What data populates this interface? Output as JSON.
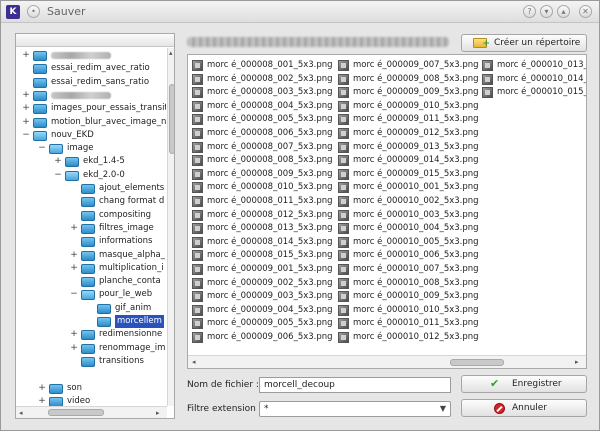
{
  "window": {
    "title": "Sauver"
  },
  "tree": {
    "items": [
      {
        "label": "",
        "blurred": true,
        "depth": 0,
        "toggle": "+",
        "blur_width": 60
      },
      {
        "label": "essai_redim_avec_ratio",
        "depth": 0,
        "toggle": ""
      },
      {
        "label": "essai_redim_sans_ratio",
        "depth": 0,
        "toggle": ""
      },
      {
        "label": "",
        "blurred": true,
        "depth": 0,
        "toggle": "+",
        "blur_width": 60
      },
      {
        "label": "images_pour_essais_transit",
        "depth": 0,
        "toggle": "+"
      },
      {
        "label": "motion_blur_avec_image_n",
        "depth": 0,
        "toggle": "+"
      },
      {
        "label": "nouv_EKD",
        "depth": 0,
        "toggle": "−",
        "open": true
      },
      {
        "label": "image",
        "depth": 1,
        "toggle": "−",
        "open": true
      },
      {
        "label": "ekd_1.4-5",
        "depth": 2,
        "toggle": "+"
      },
      {
        "label": "ekd_2.0-0",
        "depth": 2,
        "toggle": "−",
        "open": true
      },
      {
        "label": "ajout_elements",
        "depth": 3,
        "toggle": ""
      },
      {
        "label": "chang format d",
        "depth": 3,
        "toggle": ""
      },
      {
        "label": "compositing",
        "depth": 3,
        "toggle": ""
      },
      {
        "label": "filtres_image",
        "depth": 3,
        "toggle": "+"
      },
      {
        "label": "informations",
        "depth": 3,
        "toggle": ""
      },
      {
        "label": "masque_alpha_",
        "depth": 3,
        "toggle": "+"
      },
      {
        "label": "multiplication_i",
        "depth": 3,
        "toggle": "+"
      },
      {
        "label": "planche_conta",
        "depth": 3,
        "toggle": ""
      },
      {
        "label": "pour_le_web",
        "depth": 3,
        "toggle": "−",
        "open": true
      },
      {
        "label": "gif_anim",
        "depth": 4,
        "toggle": ""
      },
      {
        "label": "morcellem",
        "depth": 4,
        "toggle": "",
        "selected": true
      },
      {
        "label": "redimensionne",
        "depth": 3,
        "toggle": "+"
      },
      {
        "label": "renommage_im",
        "depth": 3,
        "toggle": "+"
      },
      {
        "label": "transitions",
        "depth": 3,
        "toggle": ""
      },
      {
        "label": "",
        "depth": 1,
        "toggle": "",
        "spacer": true
      },
      {
        "label": "son",
        "depth": 1,
        "toggle": "+"
      },
      {
        "label": "video",
        "depth": 1,
        "toggle": "+"
      }
    ]
  },
  "toolbar": {
    "new_dir_label": "Créer un répertoire"
  },
  "files": {
    "columns": [
      [
        "morc é_000008_001_5x3.png",
        "morc é_000008_002_5x3.png",
        "morc é_000008_003_5x3.png",
        "morc é_000008_004_5x3.png",
        "morc é_000008_005_5x3.png",
        "morc é_000008_006_5x3.png",
        "morc é_000008_007_5x3.png",
        "morc é_000008_008_5x3.png",
        "morc é_000008_009_5x3.png",
        "morc é_000008_010_5x3.png",
        "morc é_000008_011_5x3.png",
        "morc é_000008_012_5x3.png",
        "morc é_000008_013_5x3.png",
        "morc é_000008_014_5x3.png",
        "morc é_000008_015_5x3.png",
        "morc é_000009_001_5x3.png",
        "morc é_000009_002_5x3.png",
        "morc é_000009_003_5x3.png",
        "morc é_000009_004_5x3.png",
        "morc é_000009_005_5x3.png",
        "morc é_000009_006_5x3.png"
      ],
      [
        "morc é_000009_007_5x3.png",
        "morc é_000009_008_5x3.png",
        "morc é_000009_009_5x3.png",
        "morc é_000009_010_5x3.png",
        "morc é_000009_011_5x3.png",
        "morc é_000009_012_5x3.png",
        "morc é_000009_013_5x3.png",
        "morc é_000009_014_5x3.png",
        "morc é_000009_015_5x3.png",
        "morc é_000010_001_5x3.png",
        "morc é_000010_002_5x3.png",
        "morc é_000010_003_5x3.png",
        "morc é_000010_004_5x3.png",
        "morc é_000010_005_5x3.png",
        "morc é_000010_006_5x3.png",
        "morc é_000010_007_5x3.png",
        "morc é_000010_008_5x3.png",
        "morc é_000010_009_5x3.png",
        "morc é_000010_010_5x3.png",
        "morc é_000010_011_5x3.png",
        "morc é_000010_012_5x3.png"
      ],
      [
        "morc é_000010_013_",
        "morc é_000010_014_",
        "morc é_000010_015_"
      ]
    ]
  },
  "form": {
    "filename_label": "Nom de fichier :",
    "filename_value": "morcell_decoup",
    "filter_label": "Filtre extension :",
    "filter_value": "*",
    "save_label": "Enregistrer",
    "cancel_label": "Annuler"
  },
  "colors": {
    "selection": "#2a52be",
    "folder": "#3b9be0",
    "save_check": "#2fa12f",
    "cancel_red": "#d8232a"
  }
}
